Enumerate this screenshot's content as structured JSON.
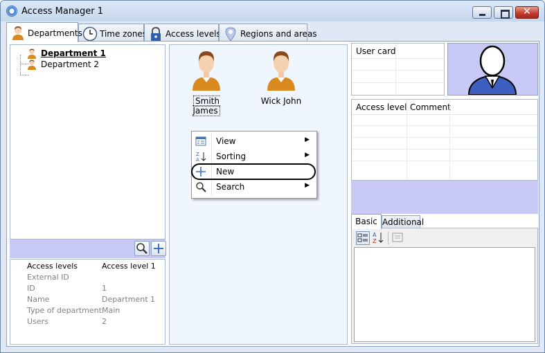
{
  "window": {
    "title": "Access Manager 1",
    "close_glyph": "✕"
  },
  "tabs": [
    {
      "label": "Departments",
      "icon": "person-icon",
      "active": true
    },
    {
      "label": "Time zones",
      "icon": "clock-icon",
      "active": false
    },
    {
      "label": "Access levels",
      "icon": "lock-icon",
      "active": false
    },
    {
      "label": "Regions and areas",
      "icon": "location-icon",
      "active": false
    }
  ],
  "tree": {
    "items": [
      {
        "label": "Department  1",
        "selected": true
      },
      {
        "label": "Department 2",
        "selected": false
      }
    ]
  },
  "properties": [
    {
      "key": "Access levels",
      "value": "Access level 1",
      "dim": false
    },
    {
      "key": "External ID",
      "value": "",
      "dim": true
    },
    {
      "key": "ID",
      "value": "1",
      "dim": true
    },
    {
      "key": "Name",
      "value": "Department 1",
      "dim": true
    },
    {
      "key": "Type of department",
      "value": "Main",
      "dim": true
    },
    {
      "key": "Users",
      "value": "2",
      "dim": true
    }
  ],
  "staff": [
    {
      "name": "Smith James",
      "focused": true
    },
    {
      "name": "Wick John",
      "focused": false
    }
  ],
  "context_menu": {
    "items": [
      {
        "label": "View",
        "icon": "view-icon",
        "submenu": true
      },
      {
        "label": "Sorting",
        "icon": "sort-az-icon",
        "submenu": true
      },
      {
        "label": "New",
        "icon": "plus-icon",
        "submenu": false,
        "highlighted": true
      },
      {
        "label": "Search",
        "icon": "magnifier-icon",
        "submenu": true
      }
    ],
    "submenu_arrow": "▶"
  },
  "user_card": {
    "header": "User card"
  },
  "access_table": {
    "columns": [
      "Access level",
      "Comment"
    ]
  },
  "subtabs": [
    {
      "label": "Basic",
      "active": true
    },
    {
      "label": "Additional",
      "active": false
    }
  ],
  "colors": {
    "lavender": "#c9c9f6",
    "person_shirt": "#d98a1f",
    "photo_shirt": "#3d5fbf"
  }
}
